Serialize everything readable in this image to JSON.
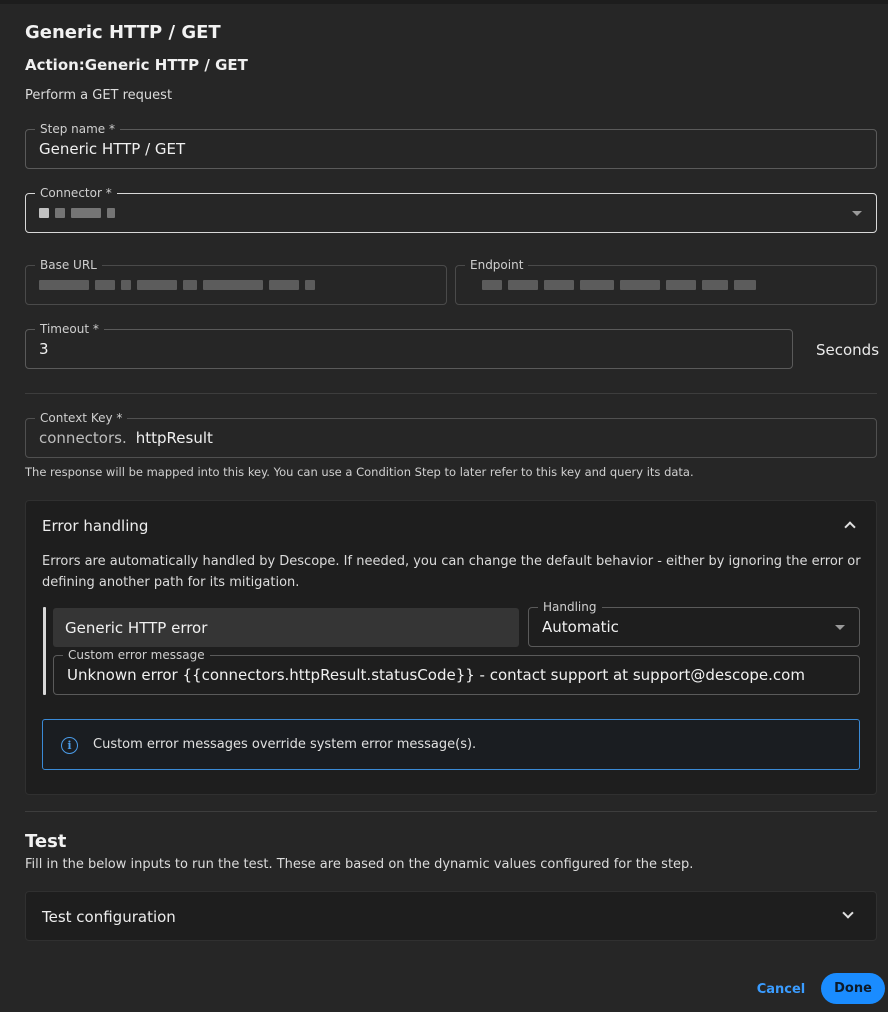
{
  "header": {
    "title": "Generic HTTP / GET",
    "action": "Action:Generic HTTP / GET",
    "description": "Perform a GET request"
  },
  "form": {
    "step_name": {
      "label": "Step name *",
      "value": "Generic HTTP / GET"
    },
    "connector": {
      "label": "Connector *"
    },
    "base_url": {
      "label": "Base URL"
    },
    "endpoint": {
      "label": "Endpoint"
    },
    "timeout": {
      "label": "Timeout *",
      "value": "3",
      "unit": "Seconds"
    },
    "context_key": {
      "label": "Context Key *",
      "prefix": "connectors.",
      "value": "httpResult",
      "helper": "The response will be mapped into this key. You can use a Condition Step to later refer to this key and query its data."
    }
  },
  "error_handling": {
    "title": "Error handling",
    "description": "Errors are automatically handled by Descope. If needed, you can change the default behavior - either by ignoring the error or defining another path for its mitigation.",
    "error_type": "Generic HTTP error",
    "handling": {
      "label": "Handling",
      "value": "Automatic"
    },
    "custom_message": {
      "label": "Custom error message",
      "value": "Unknown error {{connectors.httpResult.statusCode}} - contact support at support@descope.com"
    },
    "info": "Custom error messages override system error message(s)."
  },
  "test": {
    "title": "Test",
    "description": "Fill in the below inputs to run the test. These are based on the dynamic values configured for the step.",
    "config_title": "Test configuration"
  },
  "footer": {
    "cancel_label": "Cancel",
    "done_label": "Done"
  },
  "colors": {
    "accent": "#1a8cff",
    "info_border": "#3a8ad6",
    "background": "#262626",
    "panel": "#1e1e1e"
  }
}
